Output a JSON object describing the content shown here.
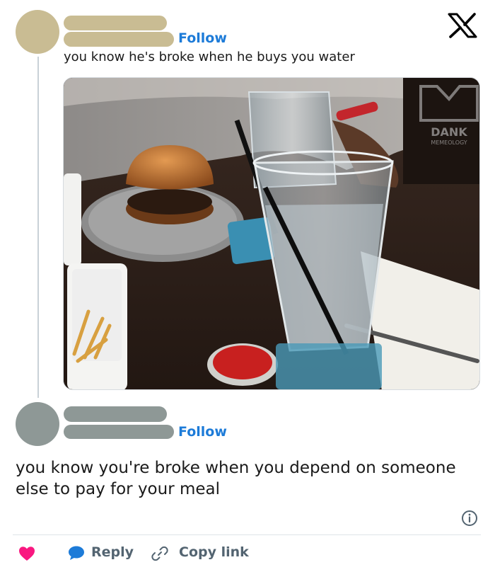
{
  "tweet": {
    "follow_label": "Follow",
    "text": "you know he's broke when he buys you water",
    "image": {
      "description_icon": "photo-burger-water-glass",
      "watermark_line1": "DANK",
      "watermark_line2": "MEMEOLOGY"
    }
  },
  "reply": {
    "follow_label": "Follow",
    "text": "you know you're broke when you depend on someone else to pay for your meal"
  },
  "actions": {
    "reply_label": "Reply",
    "copy_link_label": "Copy link"
  },
  "brand": {
    "logo_icon": "x-logo-icon",
    "accent": "#1d7bd8",
    "like_color": "#f91880",
    "muted": "#536471"
  }
}
